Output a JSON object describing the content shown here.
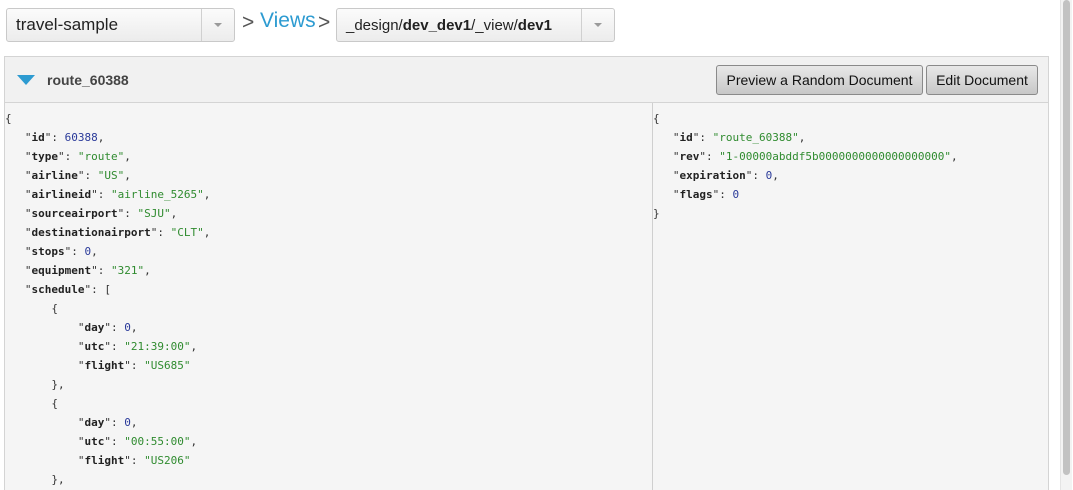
{
  "topbar": {
    "bucket": "travel-sample",
    "sep1": ">",
    "views_link": "Views",
    "sep2": ">",
    "view_prefix": "_design/",
    "view_ddoc": "dev_dev1",
    "view_mid": "/_view/",
    "view_name": "dev1"
  },
  "panel": {
    "doc_id": "route_60388",
    "preview_button": "Preview a Random Document",
    "edit_button": "Edit Document"
  },
  "document_lines": [
    [
      {
        "t": "p",
        "v": "{"
      }
    ],
    [
      {
        "t": "p",
        "v": "   "
      },
      {
        "t": "p",
        "v": "\""
      },
      {
        "t": "k",
        "v": "id"
      },
      {
        "t": "p",
        "v": "\": "
      },
      {
        "t": "n",
        "v": "60388"
      },
      {
        "t": "p",
        "v": ","
      }
    ],
    [
      {
        "t": "p",
        "v": "   \""
      },
      {
        "t": "k",
        "v": "type"
      },
      {
        "t": "p",
        "v": "\": "
      },
      {
        "t": "s",
        "v": "\"route\""
      },
      {
        "t": "p",
        "v": ","
      }
    ],
    [
      {
        "t": "p",
        "v": "   \""
      },
      {
        "t": "k",
        "v": "airline"
      },
      {
        "t": "p",
        "v": "\": "
      },
      {
        "t": "s",
        "v": "\"US\""
      },
      {
        "t": "p",
        "v": ","
      }
    ],
    [
      {
        "t": "p",
        "v": "   \""
      },
      {
        "t": "k",
        "v": "airlineid"
      },
      {
        "t": "p",
        "v": "\": "
      },
      {
        "t": "s",
        "v": "\"airline_5265\""
      },
      {
        "t": "p",
        "v": ","
      }
    ],
    [
      {
        "t": "p",
        "v": "   \""
      },
      {
        "t": "k",
        "v": "sourceairport"
      },
      {
        "t": "p",
        "v": "\": "
      },
      {
        "t": "s",
        "v": "\"SJU\""
      },
      {
        "t": "p",
        "v": ","
      }
    ],
    [
      {
        "t": "p",
        "v": "   \""
      },
      {
        "t": "k",
        "v": "destinationairport"
      },
      {
        "t": "p",
        "v": "\": "
      },
      {
        "t": "s",
        "v": "\"CLT\""
      },
      {
        "t": "p",
        "v": ","
      }
    ],
    [
      {
        "t": "p",
        "v": "   \""
      },
      {
        "t": "k",
        "v": "stops"
      },
      {
        "t": "p",
        "v": "\": "
      },
      {
        "t": "n",
        "v": "0"
      },
      {
        "t": "p",
        "v": ","
      }
    ],
    [
      {
        "t": "p",
        "v": "   \""
      },
      {
        "t": "k",
        "v": "equipment"
      },
      {
        "t": "p",
        "v": "\": "
      },
      {
        "t": "s",
        "v": "\"321\""
      },
      {
        "t": "p",
        "v": ","
      }
    ],
    [
      {
        "t": "p",
        "v": "   \""
      },
      {
        "t": "k",
        "v": "schedule"
      },
      {
        "t": "p",
        "v": "\": ["
      }
    ],
    [
      {
        "t": "p",
        "v": "       {"
      }
    ],
    [
      {
        "t": "p",
        "v": "           \""
      },
      {
        "t": "k",
        "v": "day"
      },
      {
        "t": "p",
        "v": "\": "
      },
      {
        "t": "n",
        "v": "0"
      },
      {
        "t": "p",
        "v": ","
      }
    ],
    [
      {
        "t": "p",
        "v": "           \""
      },
      {
        "t": "k",
        "v": "utc"
      },
      {
        "t": "p",
        "v": "\": "
      },
      {
        "t": "s",
        "v": "\"21:39:00\""
      },
      {
        "t": "p",
        "v": ","
      }
    ],
    [
      {
        "t": "p",
        "v": "           \""
      },
      {
        "t": "k",
        "v": "flight"
      },
      {
        "t": "p",
        "v": "\": "
      },
      {
        "t": "s",
        "v": "\"US685\""
      }
    ],
    [
      {
        "t": "p",
        "v": "       },"
      }
    ],
    [
      {
        "t": "p",
        "v": "       {"
      }
    ],
    [
      {
        "t": "p",
        "v": "           \""
      },
      {
        "t": "k",
        "v": "day"
      },
      {
        "t": "p",
        "v": "\": "
      },
      {
        "t": "n",
        "v": "0"
      },
      {
        "t": "p",
        "v": ","
      }
    ],
    [
      {
        "t": "p",
        "v": "           \""
      },
      {
        "t": "k",
        "v": "utc"
      },
      {
        "t": "p",
        "v": "\": "
      },
      {
        "t": "s",
        "v": "\"00:55:00\""
      },
      {
        "t": "p",
        "v": ","
      }
    ],
    [
      {
        "t": "p",
        "v": "           \""
      },
      {
        "t": "k",
        "v": "flight"
      },
      {
        "t": "p",
        "v": "\": "
      },
      {
        "t": "s",
        "v": "\"US206\""
      }
    ],
    [
      {
        "t": "p",
        "v": "       },"
      }
    ]
  ],
  "meta_lines": [
    [
      {
        "t": "p",
        "v": "{"
      }
    ],
    [
      {
        "t": "p",
        "v": "   \""
      },
      {
        "t": "k",
        "v": "id"
      },
      {
        "t": "p",
        "v": "\": "
      },
      {
        "t": "s",
        "v": "\"route_60388\""
      },
      {
        "t": "p",
        "v": ","
      }
    ],
    [
      {
        "t": "p",
        "v": "   \""
      },
      {
        "t": "k",
        "v": "rev"
      },
      {
        "t": "p",
        "v": "\": "
      },
      {
        "t": "s",
        "v": "\"1-00000abddf5b0000000000000000000\""
      },
      {
        "t": "p",
        "v": ","
      }
    ],
    [
      {
        "t": "p",
        "v": "   \""
      },
      {
        "t": "k",
        "v": "expiration"
      },
      {
        "t": "p",
        "v": "\": "
      },
      {
        "t": "n",
        "v": "0"
      },
      {
        "t": "p",
        "v": ","
      }
    ],
    [
      {
        "t": "p",
        "v": "   \""
      },
      {
        "t": "k",
        "v": "flags"
      },
      {
        "t": "p",
        "v": "\": "
      },
      {
        "t": "n",
        "v": "0"
      }
    ],
    [
      {
        "t": "p",
        "v": "}"
      }
    ]
  ],
  "colors": {
    "accent": "#2d9bd1",
    "string": "#2f8b2f",
    "number": "#2a3a9a"
  },
  "icons": {
    "bucket_dropdown": "chevron-down-icon",
    "view_dropdown": "chevron-down-icon",
    "expand": "triangle-down-icon"
  }
}
